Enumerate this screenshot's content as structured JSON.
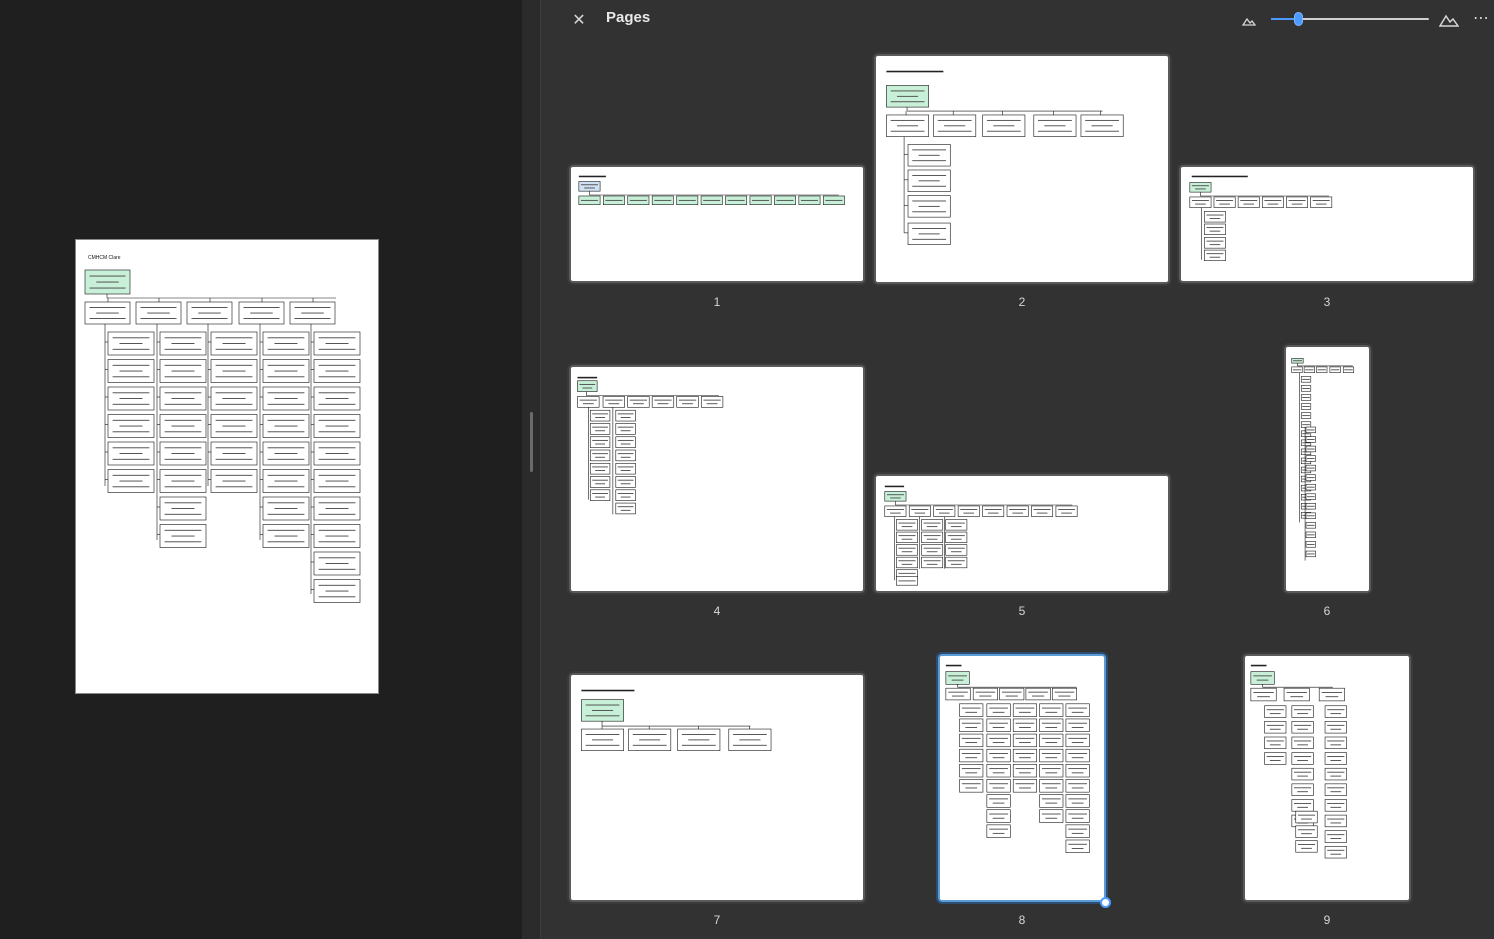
{
  "panel": {
    "title": "Pages",
    "close_icon": "close-icon",
    "zoom_out_icon": "mountain-small-icon",
    "zoom_in_icon": "mountain-large-icon",
    "more_icon": "more-horizontal-icon",
    "zoom_level": 0.17
  },
  "document": {
    "page_title": "CMHCM Clare",
    "root_box": "Jane Mosel Chief Clinical Officer for Clare/ Gladwin"
  },
  "pages": [
    {
      "number": "1",
      "title": "CMHCM Administration"
    },
    {
      "number": "2",
      "title": "CMHCM Human Resources"
    },
    {
      "number": "3",
      "title": "CMHCM Medical Records/Customer Service"
    },
    {
      "number": "4",
      "title": "CMHCM Finance"
    },
    {
      "number": "5",
      "title": "CMHCM Operations"
    },
    {
      "number": "6",
      "title": ""
    },
    {
      "number": "7",
      "title": "CMHCM Recipient Rights"
    },
    {
      "number": "8",
      "title": "CMHCM Clare"
    },
    {
      "number": "9",
      "title": "CMHCM Gladwin"
    }
  ],
  "colors": {
    "panel_bg": "#323232",
    "accent": "#4c9aff",
    "box_green": "#c8f0d8",
    "box_blue": "#cfe2f3"
  }
}
